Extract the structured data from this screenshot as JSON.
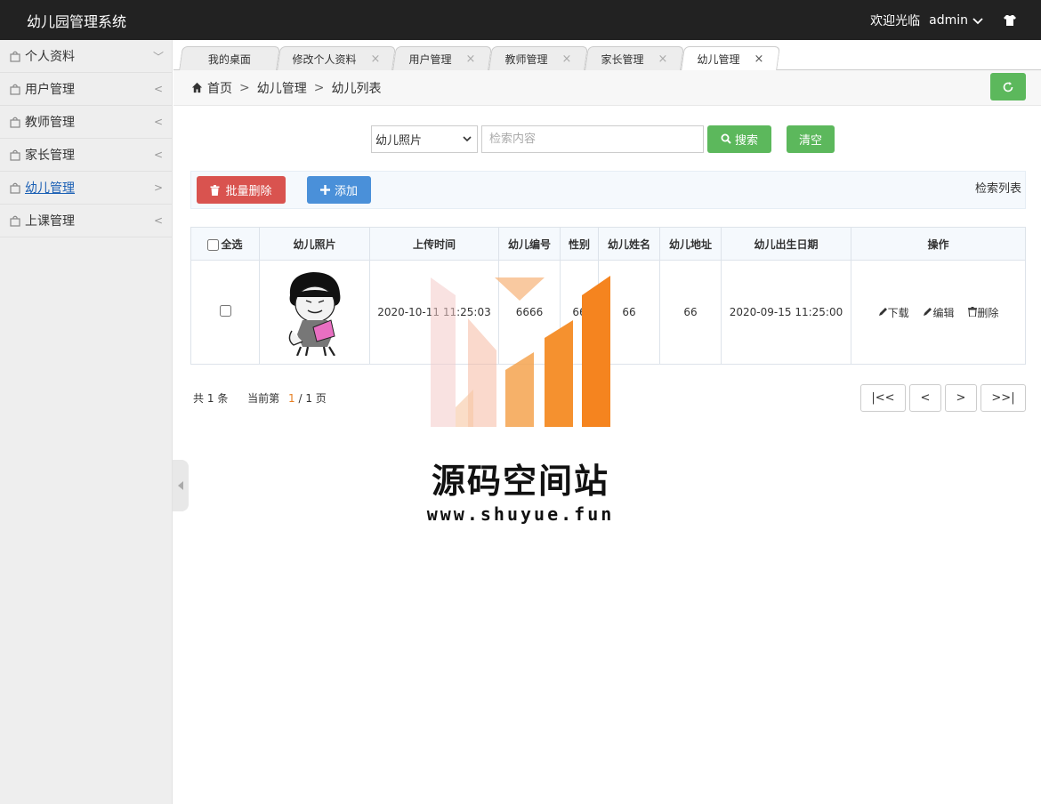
{
  "header": {
    "title": "幼儿园管理系统",
    "welcome": "欢迎光临",
    "user": "admin"
  },
  "sidebar": {
    "items": [
      {
        "label": "个人资料",
        "arrow": "﹀"
      },
      {
        "label": "用户管理",
        "arrow": "<"
      },
      {
        "label": "教师管理",
        "arrow": "<"
      },
      {
        "label": "家长管理",
        "arrow": "<"
      },
      {
        "label": "幼儿管理",
        "arrow": ">"
      },
      {
        "label": "上课管理",
        "arrow": "<"
      }
    ]
  },
  "tabs": [
    {
      "label": "我的桌面",
      "close": ""
    },
    {
      "label": "修改个人资料",
      "close": "×"
    },
    {
      "label": "用户管理",
      "close": "×"
    },
    {
      "label": "教师管理",
      "close": "×"
    },
    {
      "label": "家长管理",
      "close": "×"
    },
    {
      "label": "幼儿管理",
      "close": "×"
    }
  ],
  "breadcrumb": {
    "home": "首页",
    "level1": "幼儿管理",
    "level2": "幼儿列表",
    "sep": ">"
  },
  "search": {
    "field_selected": "幼儿照片",
    "placeholder": "检索内容",
    "search_label": "搜索",
    "clear_label": "清空"
  },
  "toolbar": {
    "batch_delete": "批量删除",
    "add": "添加",
    "title": "检索列表"
  },
  "table": {
    "columns": [
      "全选",
      "幼儿照片",
      "上传时间",
      "幼儿编号",
      "性别",
      "幼儿姓名",
      "幼儿地址",
      "幼儿出生日期",
      "操作"
    ],
    "rows": [
      {
        "upload_time": "2020-10-11 11:25:03",
        "child_id": "6666",
        "gender": "66",
        "name": "66",
        "address": "66",
        "birth": "2020-09-15 11:25:00"
      }
    ],
    "actions": {
      "download": "下载",
      "edit": "编辑",
      "delete": "删除"
    }
  },
  "pagination": {
    "total_prefix": "共",
    "total": "1",
    "total_suffix": "条",
    "current_prefix": "当前第",
    "current": "1",
    "total_pages": "/ 1 页",
    "first": "|<<",
    "prev": "<",
    "next": ">",
    "last": ">>|"
  },
  "watermark": {
    "title": "源码空间站",
    "url": "www.shuyue.fun"
  },
  "colors": {
    "header_bg": "#222222",
    "green": "#5cb85c",
    "red": "#d9534f",
    "blue": "#4a90d9",
    "orange": "#f5841f"
  }
}
